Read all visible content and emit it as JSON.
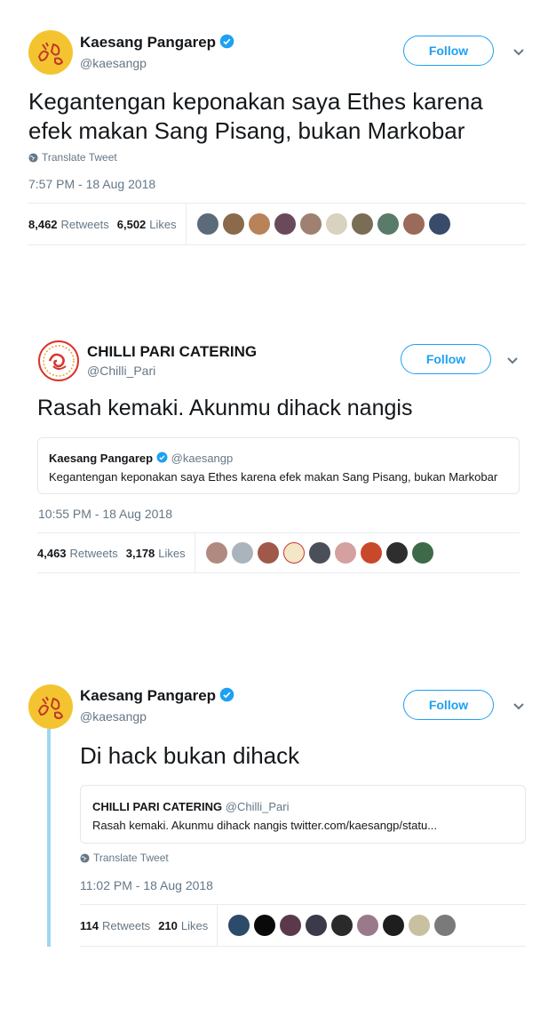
{
  "tweet1": {
    "name": "Kaesang Pangarep",
    "handle": "@kaesangp",
    "follow_label": "Follow",
    "text_line1": "Kegantengan keponakan saya Ethes karena",
    "text_line2": "efek makan Sang Pisang, bukan Markobar",
    "translate_label": "Translate Tweet",
    "timestamp": "7:57 PM - 18 Aug 2018",
    "retweets": "8,462",
    "retweets_label": "Retweets",
    "likes": "6,502",
    "likes_label": "Likes"
  },
  "tweet2": {
    "name": "CHILLI PARI CATERING",
    "handle": "@Chilli_Pari",
    "follow_label": "Follow",
    "text": "Rasah kemaki. Akunmu dihack nangis",
    "quote_name": "Kaesang Pangarep",
    "quote_handle": "@kaesangp",
    "quote_text": "Kegantengan keponakan saya Ethes karena efek makan Sang Pisang, bukan Markobar",
    "timestamp": "10:55 PM - 18 Aug 2018",
    "retweets": "4,463",
    "retweets_label": "Retweets",
    "likes": "3,178",
    "likes_label": "Likes"
  },
  "tweet3": {
    "name": "Kaesang Pangarep",
    "handle": "@kaesangp",
    "follow_label": "Follow",
    "text": "Di hack bukan dihack",
    "quote_name": "CHILLI PARI CATERING",
    "quote_handle": "@Chilli_Pari",
    "quote_text": "Rasah kemaki. Akunmu dihack nangis twitter.com/kaesangp/statu...",
    "translate_label": "Translate Tweet",
    "timestamp": "11:02 PM - 18 Aug 2018",
    "retweets": "114",
    "retweets_label": "Retweets",
    "likes": "210",
    "likes_label": "Likes"
  },
  "colors": {
    "accent": "#1da1f2",
    "muted": "#657786",
    "thread": "#9ed8ef",
    "avatar_kaesang": "#f4c430",
    "logo_red": "#d9342b"
  },
  "icons": [
    "verified-badge-icon",
    "chevron-down-icon",
    "globe-icon"
  ]
}
